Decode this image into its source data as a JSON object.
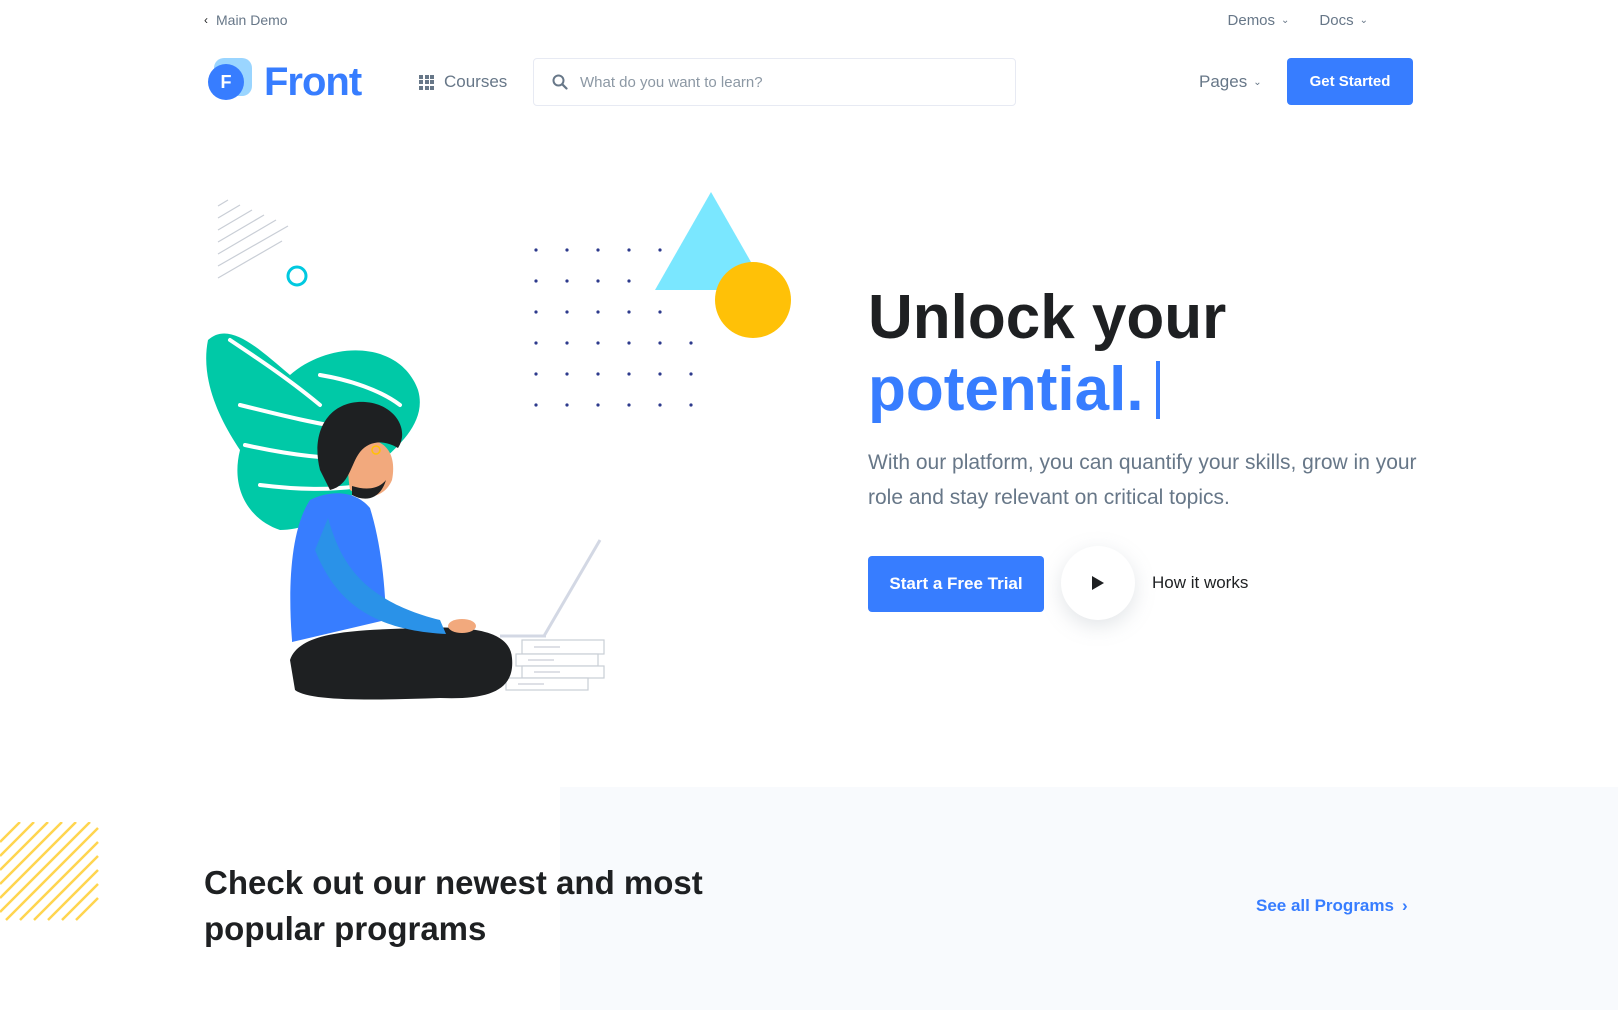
{
  "topbar": {
    "back_label": "Main Demo",
    "demos_label": "Demos",
    "docs_label": "Docs"
  },
  "header": {
    "logo_letter": "F",
    "logo_text": "Front",
    "courses_label": "Courses",
    "search_placeholder": "What do you want to learn?",
    "pages_label": "Pages",
    "cta_label": "Get Started"
  },
  "hero": {
    "title_line1": "Unlock your",
    "title_line2": "potential.",
    "description": "With our platform, you can quantify your skills, grow in your role and stay relevant on critical topics.",
    "primary_button": "Start a Free Trial",
    "secondary_label": "How it works"
  },
  "programs": {
    "title": "Check out our newest and most popular programs",
    "see_all_label": "See all Programs"
  },
  "colors": {
    "primary": "#377dff",
    "text_dark": "#1e2022",
    "text_muted": "#677788",
    "leaf": "#00c9a7",
    "accent_yellow": "#ffc107",
    "accent_cyan": "#7ae7ff"
  },
  "icons": {
    "back": "chevron-left-icon",
    "dropdown": "chevron-down-icon",
    "courses": "grid-icon",
    "search": "search-icon",
    "play": "play-icon",
    "see_all": "chevron-right-icon"
  }
}
